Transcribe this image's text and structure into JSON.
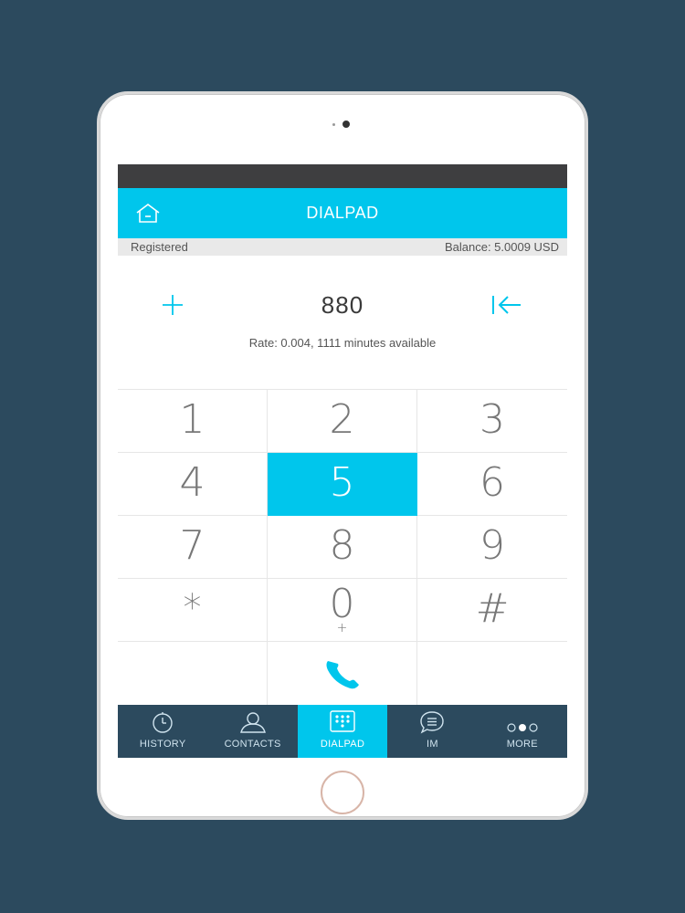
{
  "header": {
    "title": "DIALPAD"
  },
  "status": {
    "registration": "Registered",
    "balance": "Balance: 5.0009 USD"
  },
  "dialer": {
    "number": "880",
    "rate": "Rate: 0.004, 1111 minutes available"
  },
  "keypad": {
    "keys": [
      {
        "digit": "1",
        "sub": ""
      },
      {
        "digit": "2",
        "sub": ""
      },
      {
        "digit": "3",
        "sub": ""
      },
      {
        "digit": "4",
        "sub": ""
      },
      {
        "digit": "5",
        "sub": ""
      },
      {
        "digit": "6",
        "sub": ""
      },
      {
        "digit": "7",
        "sub": ""
      },
      {
        "digit": "8",
        "sub": ""
      },
      {
        "digit": "9",
        "sub": ""
      },
      {
        "digit": "*",
        "sub": ""
      },
      {
        "digit": "0",
        "sub": "+"
      },
      {
        "digit": "#",
        "sub": ""
      }
    ],
    "active_key": "5"
  },
  "tabs": [
    {
      "label": "HISTORY",
      "icon": "clock-icon"
    },
    {
      "label": "CONTACTS",
      "icon": "person-icon"
    },
    {
      "label": "DIALPAD",
      "icon": "dialpad-icon",
      "active": true
    },
    {
      "label": "IM",
      "icon": "chat-icon"
    },
    {
      "label": "MORE",
      "icon": "more-dots-icon"
    }
  ],
  "colors": {
    "accent": "#00c6ec",
    "background": "#2c4a5e",
    "statusbar": "#3e3e40"
  }
}
